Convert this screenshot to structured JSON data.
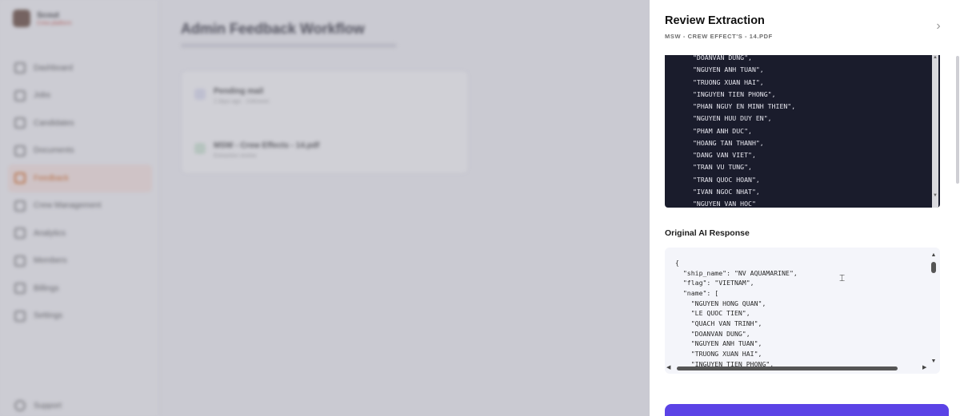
{
  "background": {
    "brand": {
      "name": "Scout",
      "tagline": "Crew platform"
    },
    "nav": [
      {
        "label": "Dashboard",
        "icon": "grid-icon"
      },
      {
        "label": "Jobs",
        "icon": "briefcase-icon"
      },
      {
        "label": "Candidates",
        "icon": "users-icon"
      },
      {
        "label": "Documents",
        "icon": "file-icon"
      },
      {
        "label": "Feedback",
        "icon": "feedback-icon",
        "active": true
      },
      {
        "label": "Crew Management",
        "icon": "crew-icon"
      },
      {
        "label": "Analytics",
        "icon": "chart-icon"
      },
      {
        "label": "Members",
        "icon": "member-icon"
      },
      {
        "label": "Billings",
        "icon": "bill-icon"
      },
      {
        "label": "Settings",
        "icon": "gear-icon"
      }
    ],
    "support": "Support",
    "page_title": "Admin Feedback Workflow",
    "entries": [
      {
        "title": "Pending mail",
        "meta": "2 days ago · Unknown"
      },
      {
        "title": "MSW - Crew Effects - 14.pdf",
        "meta": "Extraction review"
      }
    ]
  },
  "drawer": {
    "title": "Review Extraction",
    "subtitle": "MSW - CREW EFFECT'S - 14.PDF",
    "extracted_lines": [
      "\"DOANVAN DUNG\",",
      "\"NGUYEN ANH TUAN\",",
      "\"TRUONG XUAN HAI\",",
      "\"INGUYEN TIEN PHONG\",",
      "\"PHAN NGUY EN MINH THIEN\",",
      "\"NGUYEN HUU DUY EN\",",
      "\"PHAM ANH DUC\",",
      "\"HOANG TAN THANH\",",
      "\"DANG VAN VIET\",",
      "\"TRAN VU TUNG\",",
      "\"TRAN QUOC HOAN\",",
      "\"IVAN NGOC NHAT\",",
      "\"NGUYEN VAN HOC\""
    ],
    "original_label": "Original AI Response",
    "original_lines": [
      "{",
      "  \"ship_name\": \"NV AQUAMARINE\",",
      "  \"flag\": \"VIETNAM\",",
      "  \"name\": [",
      "    \"NGUYEN HONG QUAN\",",
      "    \"LE QUOC TIEN\",",
      "    \"QUACH VAN TRINH\",",
      "    \"DOANVAN DUNG\",",
      "    \"NGUYEN ANH TUAN\",",
      "    \"TRUONG XUAN HAI\",",
      "    \"INGUYEN TIEN PHONG\","
    ]
  }
}
